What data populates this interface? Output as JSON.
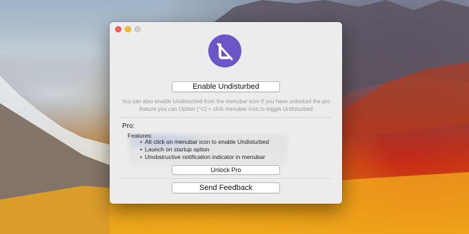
{
  "window": {
    "enable_button_label": "Enable Undisturbed",
    "description": "You can also enable Undisturbed from the menubar icon If you have unlocked the pro feature you can Option (⌥) + click menubar icon to toggle Undisturbed",
    "pro_title": "Pro:",
    "features_title": "Features:",
    "features": [
      "Alt click on menubar icon to enable Undisturbed",
      "Launch on startup option",
      "Unobstructive notification indicator in menubar"
    ],
    "unlock_button_label": "Unlock Pro",
    "feedback_button_label": "Send Feedback"
  },
  "colors": {
    "logo_bg": "#6c55c6",
    "close": "#fc5d58",
    "minimize": "#fdbc30",
    "zoom": "#cfcfcf"
  },
  "icons": {
    "app_logo": "undisturbed-logo-icon"
  }
}
